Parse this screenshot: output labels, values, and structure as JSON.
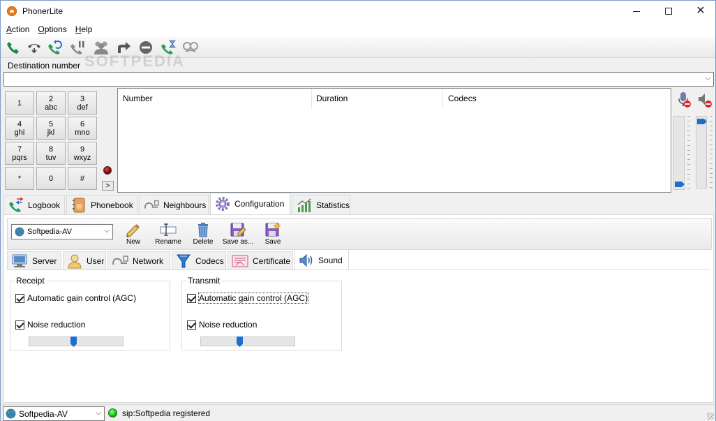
{
  "window": {
    "title": "PhonerLite"
  },
  "menu": [
    {
      "label": "Action",
      "accel": "A",
      "rest": "ction"
    },
    {
      "label": "Options",
      "accel": "O",
      "rest": "ptions"
    },
    {
      "label": "Help",
      "accel": "H",
      "rest": "elp"
    }
  ],
  "toolbar_icons": [
    "call-icon",
    "hangup-icon",
    "redial-icon",
    "hold-icon",
    "conference-icon",
    "transfer-icon",
    "reject-icon",
    "call-timer-icon",
    "mute-icon"
  ],
  "watermark": "SOFTPEDIA",
  "destination": {
    "label": "Destination number",
    "value": "",
    "placeholder": ""
  },
  "keypad": {
    "keys": [
      {
        "main": "1",
        "sub": ""
      },
      {
        "main": "2",
        "sub": "abc"
      },
      {
        "main": "3",
        "sub": "def"
      },
      {
        "main": "4",
        "sub": "ghi"
      },
      {
        "main": "5",
        "sub": "jkl"
      },
      {
        "main": "6",
        "sub": "mno"
      },
      {
        "main": "7",
        "sub": "pqrs"
      },
      {
        "main": "8",
        "sub": "tuv"
      },
      {
        "main": "9",
        "sub": "wxyz"
      },
      {
        "main": "*",
        "sub": ""
      },
      {
        "main": "0",
        "sub": ""
      },
      {
        "main": "#",
        "sub": ""
      }
    ],
    "more_label": ">"
  },
  "calls_table": {
    "columns": [
      "Number",
      "Duration",
      "Codecs"
    ],
    "rows": []
  },
  "volume": {
    "mic_level": 0.03,
    "speaker_level": 0.97
  },
  "tabs": [
    {
      "label": "Logbook",
      "icon": "logbook-icon",
      "active": false
    },
    {
      "label": "Phonebook",
      "icon": "phonebook-icon",
      "active": false
    },
    {
      "label": "Neighbours",
      "icon": "neighbours-icon",
      "active": false
    },
    {
      "label": "Configuration",
      "icon": "configuration-icon",
      "active": true
    },
    {
      "label": "Statistics",
      "icon": "statistics-icon",
      "active": false
    }
  ],
  "config": {
    "profile": "Softpedia-AV",
    "buttons": [
      {
        "label": "New",
        "icon": "new-icon"
      },
      {
        "label": "Rename",
        "icon": "rename-icon"
      },
      {
        "label": "Delete",
        "icon": "delete-icon"
      },
      {
        "label": "Save as...",
        "icon": "save-as-icon"
      },
      {
        "label": "Save",
        "icon": "save-icon"
      }
    ],
    "subtabs": [
      {
        "label": "Server",
        "icon": "server-icon",
        "active": false
      },
      {
        "label": "User",
        "icon": "user-icon",
        "active": false
      },
      {
        "label": "Network",
        "icon": "network-icon",
        "active": false
      },
      {
        "label": "Codecs",
        "icon": "codecs-icon",
        "active": false
      },
      {
        "label": "Certificate",
        "icon": "certificate-icon",
        "active": false
      },
      {
        "label": "Sound",
        "icon": "sound-icon",
        "active": true
      }
    ],
    "sound": {
      "receipt": {
        "title": "Receipt",
        "agc_label": "Automatic gain control (AGC)",
        "agc": true,
        "nr_label": "Noise reduction",
        "nr": true,
        "nr_level": 0.47
      },
      "transmit": {
        "title": "Transmit",
        "agc_label": "Automatic gain control (AGC)",
        "agc": true,
        "nr_label": "Noise reduction",
        "nr": true,
        "nr_level": 0.41
      }
    }
  },
  "status": {
    "profile": "Softpedia-AV",
    "text": "sip:Softpedia registered",
    "led_color": "#22cc22"
  }
}
